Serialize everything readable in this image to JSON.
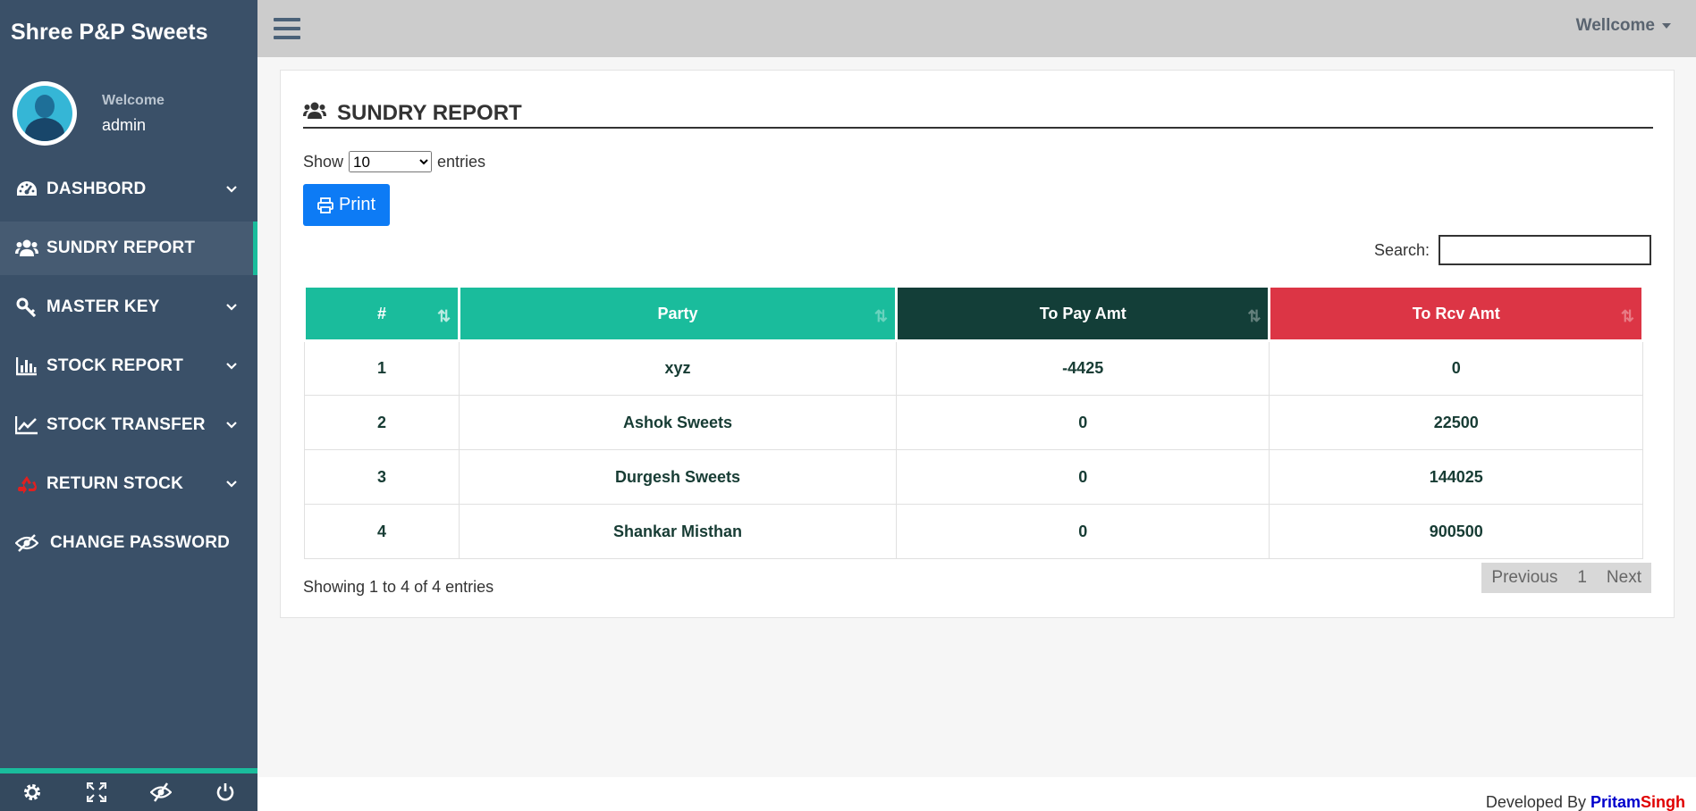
{
  "brand": "Shree P&P Sweets",
  "profile": {
    "welcome": "Welcome",
    "name": "admin"
  },
  "nav": [
    {
      "label": "DASHBORD",
      "icon": "dashboard-icon",
      "chevron": true,
      "active": false
    },
    {
      "label": "SUNDRY REPORT",
      "icon": "users-icon",
      "chevron": false,
      "active": true
    },
    {
      "label": "MASTER KEY",
      "icon": "key-icon",
      "chevron": true,
      "active": false
    },
    {
      "label": "STOCK REPORT",
      "icon": "bar-chart-icon",
      "chevron": true,
      "active": false
    },
    {
      "label": "STOCK TRANSFER",
      "icon": "line-chart-icon",
      "chevron": true,
      "active": false
    },
    {
      "label": "RETURN STOCK",
      "icon": "recycle-icon",
      "chevron": true,
      "active": false
    },
    {
      "label": "CHANGE PASSWORD",
      "icon": "eye-slash-icon",
      "chevron": false,
      "active": false
    }
  ],
  "topbar": {
    "user": "Wellcome"
  },
  "panel": {
    "title": "SUNDRY REPORT",
    "show": "Show",
    "entries": "entries",
    "length_value": "10",
    "print": "Print",
    "search_label": "Search:",
    "search_value": ""
  },
  "table": {
    "headers": [
      "#",
      "Party",
      "To Pay Amt",
      "To Rcv Amt"
    ],
    "rows": [
      [
        "1",
        "xyz",
        "-4425",
        "0"
      ],
      [
        "2",
        "Ashok Sweets",
        "0",
        "22500"
      ],
      [
        "3",
        "Durgesh Sweets",
        "0",
        "144025"
      ],
      [
        "4",
        "Shankar Misthan",
        "0",
        "900500"
      ]
    ]
  },
  "info": "Showing 1 to 4 of 4 entries",
  "pager": {
    "previous": "Previous",
    "page": "1",
    "next": "Next"
  },
  "footer": {
    "developed_by": "Developed By",
    "name_a": "Pritam",
    "name_b": "Singh"
  },
  "colors": {
    "sidebar": "#3a5068",
    "accent": "#1abc9c",
    "dark_green": "#133e38",
    "red": "#dc3545",
    "primary": "#0d7bf5"
  }
}
